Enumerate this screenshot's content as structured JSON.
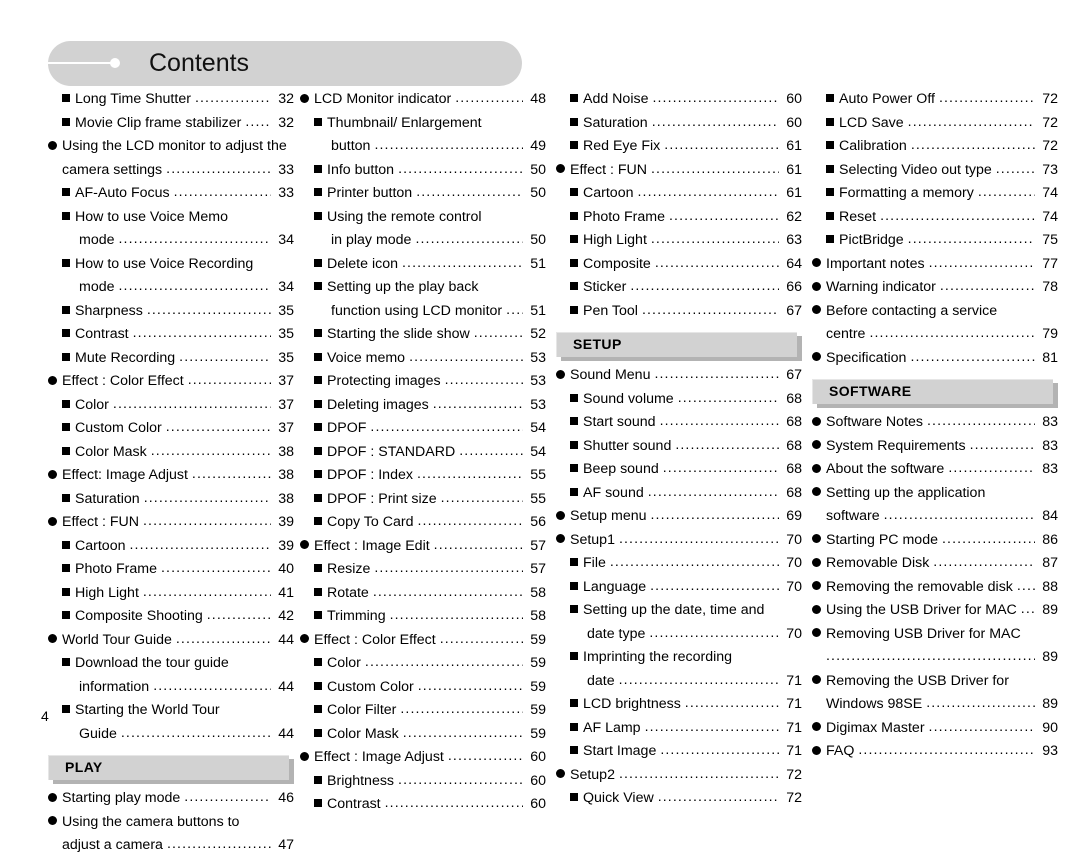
{
  "header": {
    "title": "Contents",
    "bullet_icon": "line-dot-icon"
  },
  "footer": {
    "page_number": "4"
  },
  "colors": {
    "banner_gray": "#d2d2d2",
    "section_box_gray": "#d2d2d2",
    "section_box_shadow": "#b3b3b3",
    "text": "#000000",
    "page_background": "#ffffff"
  },
  "columns": [
    {
      "id": "column-1",
      "blocks": [
        {
          "type": "entries",
          "entries": [
            {
              "bullet": "square",
              "indent": 1,
              "label": "Long Time Shutter",
              "page": "32"
            },
            {
              "bullet": "square",
              "indent": 1,
              "label": "Movie Clip frame stabilizer",
              "page": "32"
            },
            {
              "bullet": "circle",
              "indent": 0,
              "label": "Using the LCD monitor to adjust the",
              "page": ""
            },
            {
              "bullet": "none",
              "indent": 2,
              "label": "camera settings",
              "page": "33"
            },
            {
              "bullet": "square",
              "indent": 1,
              "label": "AF-Auto Focus",
              "page": "33"
            },
            {
              "bullet": "square",
              "indent": 1,
              "label": "How to use Voice Memo",
              "page": ""
            },
            {
              "bullet": "none",
              "indent": 3,
              "label": "mode",
              "page": "34"
            },
            {
              "bullet": "square",
              "indent": 1,
              "label": "How to use Voice Recording",
              "page": ""
            },
            {
              "bullet": "none",
              "indent": 3,
              "label": "mode",
              "page": "34"
            },
            {
              "bullet": "square",
              "indent": 1,
              "label": "Sharpness",
              "page": "35"
            },
            {
              "bullet": "square",
              "indent": 1,
              "label": "Contrast",
              "page": "35"
            },
            {
              "bullet": "square",
              "indent": 1,
              "label": "Mute Recording",
              "page": "35"
            },
            {
              "bullet": "circle",
              "indent": 0,
              "label": "Effect : Color Effect",
              "page": "37"
            },
            {
              "bullet": "square",
              "indent": 1,
              "label": "Color",
              "page": "37"
            },
            {
              "bullet": "square",
              "indent": 1,
              "label": "Custom Color",
              "page": "37"
            },
            {
              "bullet": "square",
              "indent": 1,
              "label": "Color Mask",
              "page": "38"
            },
            {
              "bullet": "circle",
              "indent": 0,
              "label": "Effect: Image Adjust",
              "page": "38"
            },
            {
              "bullet": "square",
              "indent": 1,
              "label": "Saturation",
              "page": "38"
            },
            {
              "bullet": "circle",
              "indent": 0,
              "label": "Effect : FUN",
              "page": "39"
            },
            {
              "bullet": "square",
              "indent": 1,
              "label": "Cartoon",
              "page": "39"
            },
            {
              "bullet": "square",
              "indent": 1,
              "label": "Photo Frame",
              "page": "40"
            },
            {
              "bullet": "square",
              "indent": 1,
              "label": "High Light",
              "page": "41"
            },
            {
              "bullet": "square",
              "indent": 1,
              "label": "Composite Shooting",
              "page": "42"
            },
            {
              "bullet": "circle",
              "indent": 0,
              "label": "World Tour Guide",
              "page": "44"
            },
            {
              "bullet": "square",
              "indent": 1,
              "label": "Download the tour guide",
              "page": ""
            },
            {
              "bullet": "none",
              "indent": 3,
              "label": "information",
              "page": "44"
            },
            {
              "bullet": "square",
              "indent": 1,
              "label": "Starting the World Tour",
              "page": ""
            },
            {
              "bullet": "none",
              "indent": 3,
              "label": "Guide",
              "page": "44"
            }
          ]
        },
        {
          "type": "section",
          "label": "PLAY"
        },
        {
          "type": "entries",
          "entries": [
            {
              "bullet": "circle",
              "indent": 0,
              "label": "Starting play mode",
              "page": "46"
            },
            {
              "bullet": "circle",
              "indent": 0,
              "label": "Using the camera buttons to",
              "page": ""
            },
            {
              "bullet": "none",
              "indent": 2,
              "label": "adjust a camera",
              "page": "47"
            }
          ]
        }
      ]
    },
    {
      "id": "column-2",
      "blocks": [
        {
          "type": "entries",
          "entries": [
            {
              "bullet": "circle",
              "indent": 0,
              "label": "LCD Monitor indicator",
              "page": "48"
            },
            {
              "bullet": "square",
              "indent": 1,
              "label": "Thumbnail/ Enlargement",
              "page": ""
            },
            {
              "bullet": "none",
              "indent": 3,
              "label": "button",
              "page": "49"
            },
            {
              "bullet": "square",
              "indent": 1,
              "label": "Info button",
              "page": "50"
            },
            {
              "bullet": "square",
              "indent": 1,
              "label": "Printer button",
              "page": "50"
            },
            {
              "bullet": "square",
              "indent": 1,
              "label": "Using the remote control",
              "page": ""
            },
            {
              "bullet": "none",
              "indent": 3,
              "label": "in play mode",
              "page": "50"
            },
            {
              "bullet": "square",
              "indent": 1,
              "label": "Delete icon",
              "page": "51"
            },
            {
              "bullet": "square",
              "indent": 1,
              "label": "Setting up the play back",
              "page": ""
            },
            {
              "bullet": "none",
              "indent": 3,
              "label": "function using LCD monitor",
              "page": "51"
            },
            {
              "bullet": "square",
              "indent": 1,
              "label": "Starting the slide show",
              "page": "52"
            },
            {
              "bullet": "square",
              "indent": 1,
              "label": "Voice memo",
              "page": "53"
            },
            {
              "bullet": "square",
              "indent": 1,
              "label": "Protecting images",
              "page": "53"
            },
            {
              "bullet": "square",
              "indent": 1,
              "label": "Deleting images",
              "page": "53"
            },
            {
              "bullet": "square",
              "indent": 1,
              "label": "DPOF",
              "page": "54"
            },
            {
              "bullet": "square",
              "indent": 1,
              "label": "DPOF : STANDARD",
              "page": "54"
            },
            {
              "bullet": "square",
              "indent": 1,
              "label": "DPOF : Index",
              "page": "55"
            },
            {
              "bullet": "square",
              "indent": 1,
              "label": "DPOF : Print size",
              "page": "55"
            },
            {
              "bullet": "square",
              "indent": 1,
              "label": "Copy To Card",
              "page": "56"
            },
            {
              "bullet": "circle",
              "indent": 0,
              "label": "Effect : Image Edit",
              "page": "57"
            },
            {
              "bullet": "square",
              "indent": 1,
              "label": "Resize",
              "page": "57"
            },
            {
              "bullet": "square",
              "indent": 1,
              "label": "Rotate",
              "page": "58"
            },
            {
              "bullet": "square",
              "indent": 1,
              "label": "Trimming",
              "page": "58"
            },
            {
              "bullet": "circle",
              "indent": 0,
              "label": "Effect : Color Effect",
              "page": "59"
            },
            {
              "bullet": "square",
              "indent": 1,
              "label": "Color",
              "page": "59"
            },
            {
              "bullet": "square",
              "indent": 1,
              "label": "Custom Color",
              "page": "59"
            },
            {
              "bullet": "square",
              "indent": 1,
              "label": "Color Filter",
              "page": "59"
            },
            {
              "bullet": "square",
              "indent": 1,
              "label": "Color Mask",
              "page": "59"
            },
            {
              "bullet": "circle",
              "indent": 0,
              "label": "Effect : Image Adjust",
              "page": "60"
            },
            {
              "bullet": "square",
              "indent": 1,
              "label": "Brightness",
              "page": "60"
            },
            {
              "bullet": "square",
              "indent": 1,
              "label": "Contrast",
              "page": "60"
            }
          ]
        }
      ]
    },
    {
      "id": "column-3",
      "blocks": [
        {
          "type": "entries",
          "entries": [
            {
              "bullet": "square",
              "indent": 1,
              "label": "Add Noise",
              "page": "60"
            },
            {
              "bullet": "square",
              "indent": 1,
              "label": "Saturation",
              "page": "60"
            },
            {
              "bullet": "square",
              "indent": 1,
              "label": "Red Eye Fix",
              "page": "61"
            },
            {
              "bullet": "circle",
              "indent": 0,
              "label": "Effect : FUN",
              "page": "61"
            },
            {
              "bullet": "square",
              "indent": 1,
              "label": "Cartoon",
              "page": "61"
            },
            {
              "bullet": "square",
              "indent": 1,
              "label": "Photo Frame",
              "page": "62"
            },
            {
              "bullet": "square",
              "indent": 1,
              "label": "High Light",
              "page": "63"
            },
            {
              "bullet": "square",
              "indent": 1,
              "label": "Composite",
              "page": "64"
            },
            {
              "bullet": "square",
              "indent": 1,
              "label": "Sticker",
              "page": "66"
            },
            {
              "bullet": "square",
              "indent": 1,
              "label": "Pen Tool",
              "page": "67"
            }
          ]
        },
        {
          "type": "section",
          "label": "SETUP"
        },
        {
          "type": "entries",
          "entries": [
            {
              "bullet": "circle",
              "indent": 0,
              "label": "Sound Menu",
              "page": "67"
            },
            {
              "bullet": "square",
              "indent": 1,
              "label": "Sound volume",
              "page": "68"
            },
            {
              "bullet": "square",
              "indent": 1,
              "label": "Start sound",
              "page": "68"
            },
            {
              "bullet": "square",
              "indent": 1,
              "label": "Shutter sound",
              "page": "68"
            },
            {
              "bullet": "square",
              "indent": 1,
              "label": "Beep sound",
              "page": "68"
            },
            {
              "bullet": "square",
              "indent": 1,
              "label": "AF sound",
              "page": "68"
            },
            {
              "bullet": "circle",
              "indent": 0,
              "label": "Setup menu",
              "page": "69"
            },
            {
              "bullet": "circle",
              "indent": 0,
              "label": "Setup1",
              "page": "70"
            },
            {
              "bullet": "square",
              "indent": 1,
              "label": "File",
              "page": "70"
            },
            {
              "bullet": "square",
              "indent": 1,
              "label": "Language",
              "page": "70"
            },
            {
              "bullet": "square",
              "indent": 1,
              "label": "Setting up the date, time and",
              "page": ""
            },
            {
              "bullet": "none",
              "indent": 3,
              "label": "date type",
              "page": "70"
            },
            {
              "bullet": "square",
              "indent": 1,
              "label": "Imprinting the recording",
              "page": ""
            },
            {
              "bullet": "none",
              "indent": 3,
              "label": "date",
              "page": "71"
            },
            {
              "bullet": "square",
              "indent": 1,
              "label": "LCD brightness",
              "page": "71"
            },
            {
              "bullet": "square",
              "indent": 1,
              "label": "AF Lamp",
              "page": "71"
            },
            {
              "bullet": "square",
              "indent": 1,
              "label": "Start Image",
              "page": "71"
            },
            {
              "bullet": "circle",
              "indent": 0,
              "label": "Setup2",
              "page": "72"
            },
            {
              "bullet": "square",
              "indent": 1,
              "label": "Quick View",
              "page": "72"
            }
          ]
        }
      ]
    },
    {
      "id": "column-4",
      "blocks": [
        {
          "type": "entries",
          "entries": [
            {
              "bullet": "square",
              "indent": 1,
              "label": "Auto Power Off",
              "page": "72"
            },
            {
              "bullet": "square",
              "indent": 1,
              "label": "LCD Save",
              "page": "72"
            },
            {
              "bullet": "square",
              "indent": 1,
              "label": "Calibration",
              "page": "72"
            },
            {
              "bullet": "square",
              "indent": 1,
              "label": "Selecting Video out type",
              "page": "73"
            },
            {
              "bullet": "square",
              "indent": 1,
              "label": "Formatting a memory",
              "page": "74"
            },
            {
              "bullet": "square",
              "indent": 1,
              "label": "Reset",
              "page": "74"
            },
            {
              "bullet": "square",
              "indent": 1,
              "label": "PictBridge",
              "page": "75"
            },
            {
              "bullet": "circle",
              "indent": 0,
              "label": "Important notes",
              "page": "77"
            },
            {
              "bullet": "circle",
              "indent": 0,
              "label": "Warning indicator",
              "page": "78"
            },
            {
              "bullet": "circle",
              "indent": 0,
              "label": "Before contacting a service",
              "page": ""
            },
            {
              "bullet": "none",
              "indent": 2,
              "label": "centre",
              "page": "79"
            },
            {
              "bullet": "circle",
              "indent": 0,
              "label": "Specification",
              "page": "81"
            }
          ]
        },
        {
          "type": "section",
          "label": "SOFTWARE"
        },
        {
          "type": "entries",
          "entries": [
            {
              "bullet": "circle",
              "indent": 0,
              "label": "Software Notes",
              "page": "83"
            },
            {
              "bullet": "circle",
              "indent": 0,
              "label": "System Requirements",
              "page": "83"
            },
            {
              "bullet": "circle",
              "indent": 0,
              "label": "About the software",
              "page": "83"
            },
            {
              "bullet": "circle",
              "indent": 0,
              "label": "Setting up the application",
              "page": ""
            },
            {
              "bullet": "none",
              "indent": 2,
              "label": "software",
              "page": "84"
            },
            {
              "bullet": "circle",
              "indent": 0,
              "label": "Starting PC mode",
              "page": "86"
            },
            {
              "bullet": "circle",
              "indent": 0,
              "label": "Removable Disk",
              "page": "87"
            },
            {
              "bullet": "circle",
              "indent": 0,
              "label": "Removing the removable disk",
              "page": "88"
            },
            {
              "bullet": "circle",
              "indent": 0,
              "label": "Using the USB Driver for MAC",
              "page": "89"
            },
            {
              "bullet": "circle",
              "indent": 0,
              "label": "Removing USB Driver for MAC",
              "page": ""
            },
            {
              "bullet": "none",
              "indent": 2,
              "label": "",
              "page": "89"
            },
            {
              "bullet": "circle",
              "indent": 0,
              "label": "Removing the USB Driver for",
              "page": ""
            },
            {
              "bullet": "none",
              "indent": 2,
              "label": "Windows 98SE",
              "page": "89"
            },
            {
              "bullet": "circle",
              "indent": 0,
              "label": "Digimax Master",
              "page": "90"
            },
            {
              "bullet": "circle",
              "indent": 0,
              "label": "FAQ",
              "page": "93"
            }
          ]
        }
      ]
    }
  ]
}
